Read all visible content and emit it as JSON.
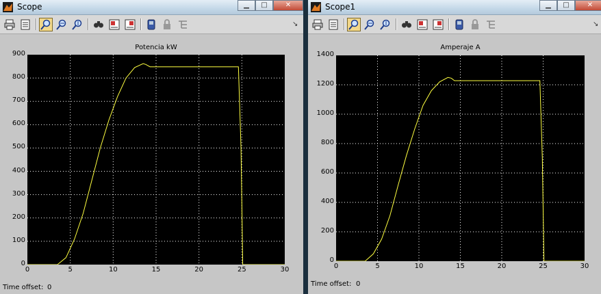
{
  "windows": [
    {
      "title": "Scope",
      "time_offset_label": "Time offset:",
      "time_offset_value": "0",
      "chart": {
        "title": "Potencia kW",
        "xlabel": "",
        "ylabel": "",
        "xlim": [
          0,
          30
        ],
        "ylim": [
          0,
          900
        ],
        "xticks": [
          0,
          5,
          10,
          15,
          20,
          25,
          30
        ],
        "yticks": [
          0,
          100,
          200,
          300,
          400,
          500,
          600,
          700,
          800,
          900
        ]
      }
    },
    {
      "title": "Scope1",
      "time_offset_label": "Time offset:",
      "time_offset_value": "0",
      "chart": {
        "title": "Amperaje A",
        "xlabel": "",
        "ylabel": "",
        "xlim": [
          0,
          30
        ],
        "ylim": [
          0,
          1400
        ],
        "xticks": [
          0,
          5,
          10,
          15,
          20,
          25,
          30
        ],
        "yticks": [
          0,
          200,
          400,
          600,
          800,
          1000,
          1200,
          1400
        ]
      }
    }
  ],
  "toolbar_icons": [
    "print-icon",
    "parameters-icon",
    "zoom-icon",
    "zoom-x-icon",
    "zoom-y-icon",
    "autoscale-icon",
    "save-axes-icon",
    "restore-axes-icon",
    "floating-scope-icon",
    "lock-icon",
    "signal-selection-icon"
  ],
  "colors": {
    "plot_bg": "#000000",
    "trace": "#ffff40",
    "grid": "#ffffff",
    "window_bg": "#c6c6c6"
  },
  "chart_data": [
    {
      "type": "line",
      "title": "Potencia kW",
      "xlabel": "",
      "ylabel": "",
      "xlim": [
        0,
        30
      ],
      "ylim": [
        0,
        900
      ],
      "grid": true,
      "series": [
        {
          "color": "#ffff40",
          "x": [
            0,
            3.5,
            4.5,
            5.5,
            6.5,
            7.5,
            8.5,
            9.5,
            10.5,
            11.5,
            12.5,
            13.5,
            13.8,
            14.3,
            24.6,
            24.9,
            25.1,
            30
          ],
          "y": [
            0,
            0,
            30,
            110,
            220,
            360,
            500,
            620,
            720,
            800,
            845,
            862,
            858,
            848,
            848,
            500,
            0,
            0
          ]
        }
      ]
    },
    {
      "type": "line",
      "title": "Amperaje A",
      "xlabel": "",
      "ylabel": "",
      "xlim": [
        0,
        30
      ],
      "ylim": [
        0,
        1400
      ],
      "grid": true,
      "series": [
        {
          "color": "#ffff40",
          "x": [
            0,
            3.5,
            4.5,
            5.5,
            6.5,
            7.5,
            8.5,
            9.5,
            10.5,
            11.5,
            12.5,
            13.5,
            13.9,
            14.3,
            24.6,
            24.9,
            25.1,
            30
          ],
          "y": [
            0,
            0,
            50,
            150,
            310,
            520,
            720,
            900,
            1060,
            1160,
            1220,
            1250,
            1245,
            1228,
            1228,
            700,
            0,
            0
          ]
        }
      ]
    }
  ]
}
